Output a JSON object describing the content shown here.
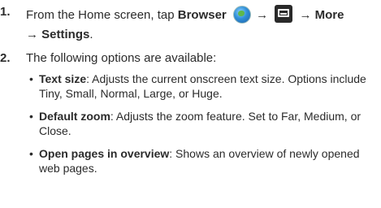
{
  "steps": [
    {
      "number": "1.",
      "line1_prefix": "From the Home screen, tap ",
      "browser": "Browser",
      "arrow1": " → ",
      "arrow2": " → ",
      "more": "More",
      "line2_arrow": "→ ",
      "settings": "Settings",
      "line2_suffix": "."
    },
    {
      "number": "2.",
      "text": "The following options are available:"
    }
  ],
  "options": [
    {
      "term": "Text size",
      "desc": ": Adjusts the current onscreen text size. Options include Tiny, Small, Normal, Large, or Huge."
    },
    {
      "term": "Default zoom",
      "desc": ": Adjusts the zoom feature. Set to Far, Medium, or Close."
    },
    {
      "term": "Open pages in overview",
      "desc": ": Shows an overview of newly opened web pages."
    }
  ],
  "icons": {
    "browser": "browser-globe-icon",
    "menu": "menu-key-icon"
  }
}
